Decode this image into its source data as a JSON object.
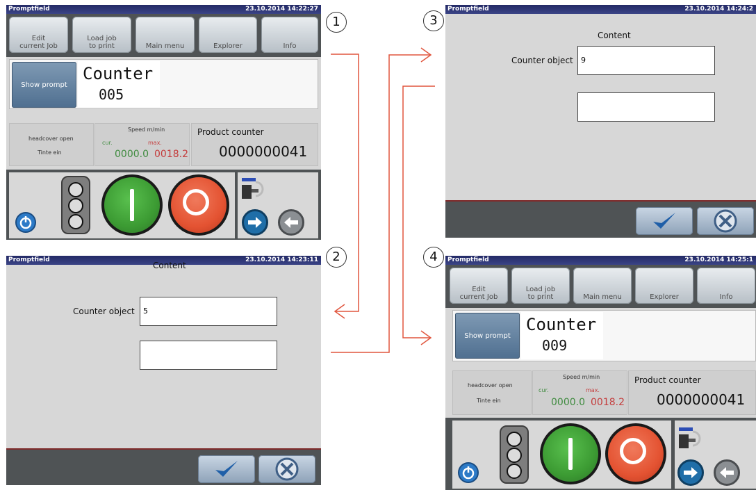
{
  "steps": [
    "1",
    "2",
    "3",
    "4"
  ],
  "screen1": {
    "title": "Promptfield",
    "datetime": "23.10.2014 14:22:27",
    "menu": [
      "Edit\ncurrent Job",
      "Load job\nto print",
      "Main menu",
      "Explorer",
      "Info"
    ],
    "show_prompt": "Show prompt",
    "counter_label": "Counter",
    "counter_value": "005",
    "headcover": "headcover open",
    "ink": "Tinte ein",
    "speed_label": "Speed  m/min",
    "cur_label": "cur.",
    "max_label": "max.",
    "cur_value": "0000.0",
    "max_value": "0018.2",
    "product_counter_label": "Product counter",
    "product_counter_value": "0000000041"
  },
  "screen2": {
    "title": "Promptfield",
    "datetime": "23.10.2014 14:23:11",
    "content_label": "Content",
    "field_label": "Counter object",
    "field_value": "5",
    "field2_value": ""
  },
  "screen3": {
    "title": "Promptfield",
    "datetime": "23.10.2014 14:24:2",
    "content_label": "Content",
    "field_label": "Counter object",
    "field_value": "9",
    "field2_value": ""
  },
  "screen4": {
    "title": "Promptfield",
    "datetime": "23.10.2014 14:25:1",
    "menu": [
      "Edit\ncurrent Job",
      "Load job\nto print",
      "Main menu",
      "Explorer",
      "Info"
    ],
    "show_prompt": "Show prompt",
    "counter_label": "Counter",
    "counter_value": "009",
    "headcover": "headcover open",
    "ink": "Tinte ein",
    "speed_label": "Speed  m/min",
    "cur_label": "cur.",
    "max_label": "max.",
    "cur_value": "0000.0",
    "max_value": "0018.2",
    "product_counter_label": "Product counter",
    "product_counter_value": "0000000041"
  },
  "colors": {
    "arrow": "#e0553d",
    "titlebar": "#2a3170",
    "panel": "#4f5355"
  },
  "icons": [
    "power-icon",
    "traffic-light-icon",
    "start-button-icon",
    "stop-button-icon",
    "forward-arrow-icon",
    "back-arrow-icon",
    "checkmark-icon",
    "cancel-icon"
  ]
}
